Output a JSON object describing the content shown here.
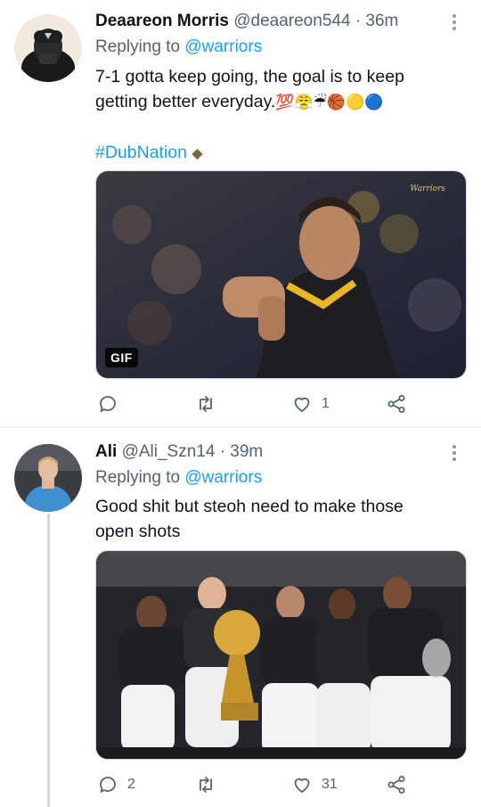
{
  "tweets": [
    {
      "author": "Deaareon Morris",
      "handle": "@deaareon544",
      "separator": "·",
      "time": "36m",
      "replying_prefix": "Replying to",
      "replying_to": "@warriors",
      "text_line1": "7-1 gotta keep going, the goal is to keep",
      "text_line2": "getting better everyday.",
      "emojis": "💯😤☔🏀🟡🔵",
      "hashtag": "#DubNation",
      "hashtag_emoji": "◆",
      "media_badge": "GIF",
      "media_watermark": "Warriors",
      "actions": {
        "reply_count": "",
        "retweet_count": "",
        "like_count": "1"
      }
    },
    {
      "author": "Ali",
      "handle": "@Ali_Szn14",
      "separator": "·",
      "time": "39m",
      "replying_prefix": "Replying to",
      "replying_to": "@warriors",
      "text_line1": "Good shit but steoh need to make those",
      "text_line2": "open shots",
      "actions": {
        "reply_count": "2",
        "retweet_count": "",
        "like_count": "31"
      }
    }
  ],
  "colors": {
    "accent": "#1d9bf0",
    "muted": "#536471",
    "text": "#0f1419"
  },
  "icons": [
    "reply-icon",
    "retweet-icon",
    "like-icon",
    "share-icon",
    "more-icon"
  ]
}
